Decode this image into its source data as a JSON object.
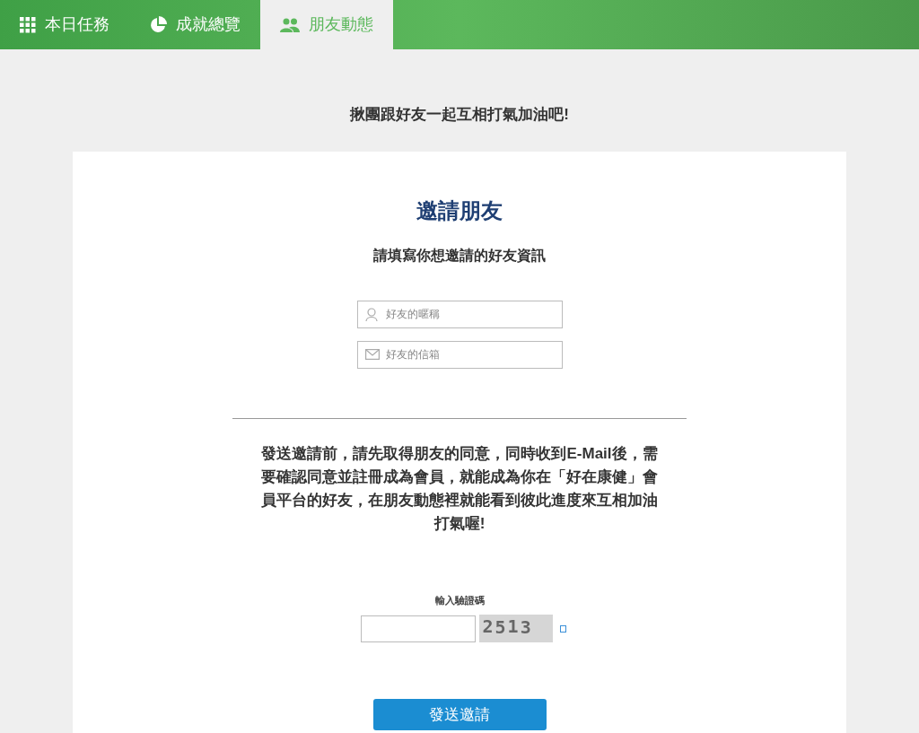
{
  "tabs": [
    {
      "label": "本日任務",
      "kind": "grid",
      "selected": false
    },
    {
      "label": "成就總覽",
      "kind": "pie",
      "selected": false
    },
    {
      "label": "朋友動態",
      "kind": "people",
      "selected": true
    }
  ],
  "intro": "揪團跟好友一起互相打氣加油吧!",
  "card": {
    "title": "邀請朋友",
    "subtitle": "請填寫你想邀請的好友資訊",
    "fields": [
      {
        "kind": "person",
        "placeholder": "好友的暱稱"
      },
      {
        "kind": "mail",
        "placeholder": "好友的信箱"
      }
    ],
    "notice": "發送邀請前，請先取得朋友的同意，同時收到**E-Mail**後，需要確認同意並註冊成為會員，就能成為你在「好在康健」會員平台的好友，在朋友動態裡就能看到彼此進度來互相加油打氣喔!",
    "captcha": {
      "label": "輸入驗證碼",
      "code": [
        "2",
        "5",
        "1",
        "3"
      ]
    },
    "submit": "發送邀請"
  }
}
